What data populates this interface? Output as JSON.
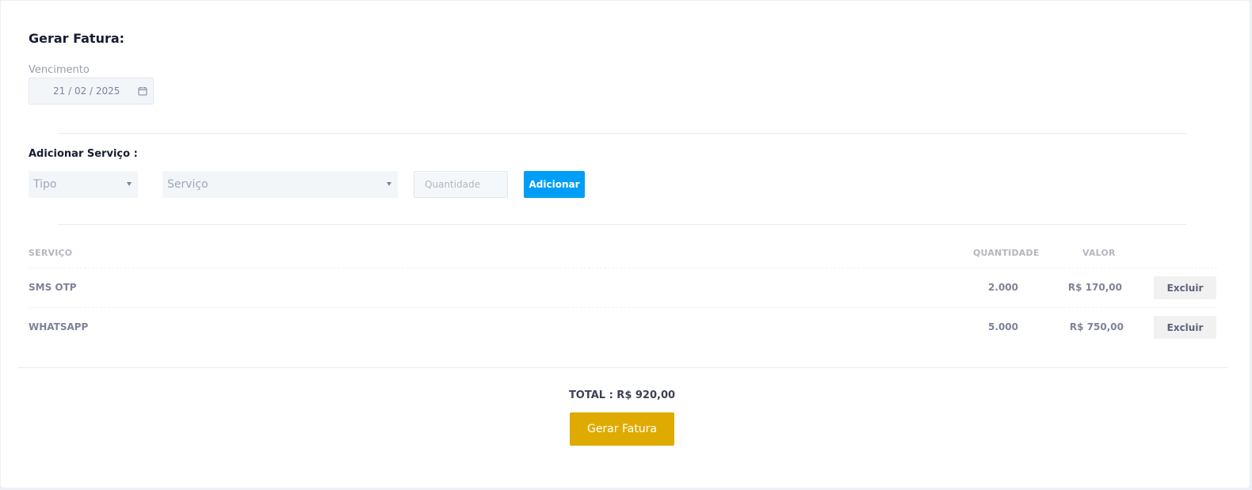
{
  "form": {
    "title": "Gerar Fatura:",
    "due_label": "Vencimento",
    "due_value": "21 / 02 / 2025"
  },
  "add_service": {
    "title": "Adicionar Serviço :",
    "tipo_selected": "Tipo",
    "servico_selected": "Serviço",
    "quantity_placeholder": "Quantidade",
    "add_label": "Adicionar"
  },
  "table": {
    "headers": {
      "service": "SERVIÇO",
      "quantity": "QUANTIDADE",
      "value": "VALOR"
    },
    "rows": [
      {
        "service": "SMS OTP",
        "quantity": "2.000",
        "value": "R$ 170,00",
        "action": "Excluir"
      },
      {
        "service": "WHATSAPP",
        "quantity": "5.000",
        "value": "R$ 750,00",
        "action": "Excluir"
      }
    ]
  },
  "summary": {
    "total": "TOTAL : R$ 920,00",
    "generate_label": "Gerar Fatura"
  },
  "colors": {
    "primary": "#009ef7",
    "warning": "#dfab00",
    "title": "#181c32",
    "muted": "#7e8299"
  },
  "icons": [
    "calendar-icon",
    "chevron-down-icon"
  ]
}
